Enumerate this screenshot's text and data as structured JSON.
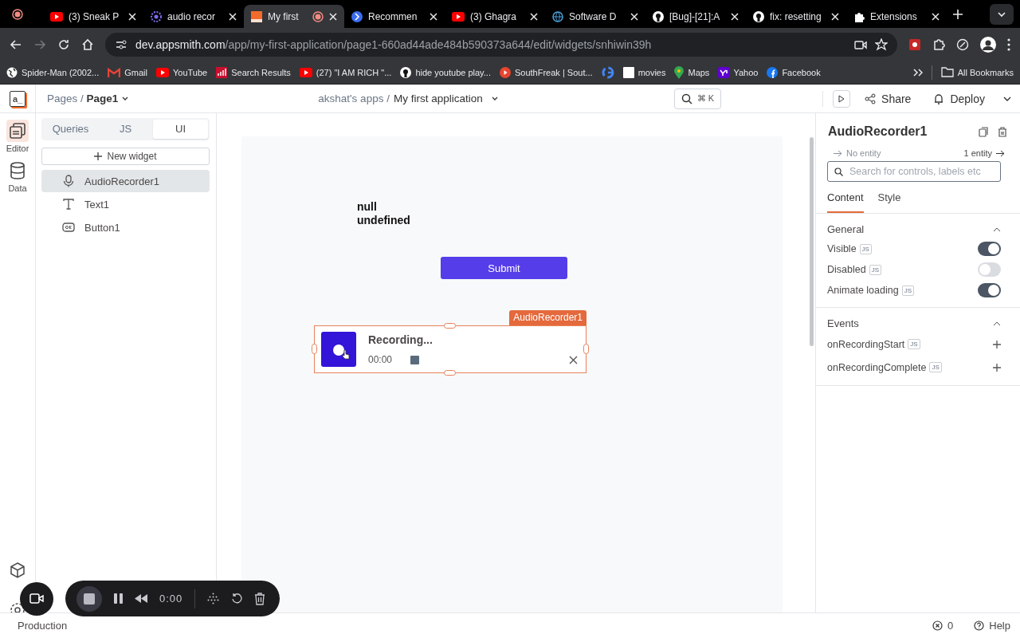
{
  "browser": {
    "tabs": [
      {
        "title": "(3) Sneak P",
        "selected": false
      },
      {
        "title": "audio recor",
        "selected": false
      },
      {
        "title": "My first",
        "selected": true
      },
      {
        "title": "Recommen",
        "selected": false
      },
      {
        "title": "(3) Ghagra",
        "selected": false
      },
      {
        "title": "Software D",
        "selected": false
      },
      {
        "title": "[Bug]-[21]:A",
        "selected": false
      },
      {
        "title": "fix: resetting",
        "selected": false
      },
      {
        "title": "Extensions",
        "selected": false
      }
    ],
    "address": {
      "host": "dev.appsmith.com",
      "path": "/app/my-first-application/page1-660ad44ade484b590373a644/edit/widgets/snhiwin39h"
    },
    "bookmarks": [
      {
        "kind": "link",
        "label": "Spider-Man (2002..."
      },
      {
        "kind": "link",
        "label": "Gmail"
      },
      {
        "kind": "link",
        "label": "YouTube"
      },
      {
        "kind": "link",
        "label": "Search Results"
      },
      {
        "kind": "link",
        "label": "(27) \"I AM RICH \"..."
      },
      {
        "kind": "link",
        "label": "hide youtube play..."
      },
      {
        "kind": "link",
        "label": "SouthFreak | Sout..."
      },
      {
        "kind": "icon"
      },
      {
        "kind": "link",
        "label": "movies"
      },
      {
        "kind": "link",
        "label": "Maps"
      },
      {
        "kind": "link",
        "label": "Yahoo"
      },
      {
        "kind": "link",
        "label": "Facebook"
      }
    ],
    "all_bookmarks": "All Bookmarks"
  },
  "header": {
    "logo": "a_",
    "pages_label": "Pages /",
    "page": "Page1",
    "workspace": "akshat's apps /",
    "app_name": "My first application",
    "search_shortcut": "⌘ K",
    "share": "Share",
    "deploy": "Deploy"
  },
  "rail": {
    "items": [
      {
        "label": "Editor",
        "selected": true
      },
      {
        "label": "Data",
        "selected": false
      }
    ]
  },
  "entities": {
    "tabs": [
      {
        "label": "Queries",
        "selected": false
      },
      {
        "label": "JS",
        "selected": false
      },
      {
        "label": "UI",
        "selected": true
      }
    ],
    "new_widget": "New widget",
    "items": [
      {
        "kind": "audio",
        "name": "AudioRecorder1",
        "selected": true
      },
      {
        "kind": "text",
        "name": "Text1",
        "selected": false
      },
      {
        "kind": "button",
        "name": "Button1",
        "selected": false
      }
    ]
  },
  "canvas": {
    "text_lines": [
      "null",
      "undefined"
    ],
    "button": "Submit",
    "recorder": {
      "tag": "AudioRecorder1",
      "selected": true,
      "status": "Recording...",
      "time": "00:00"
    }
  },
  "properties": {
    "title": "AudioRecorder1",
    "back": "No entity",
    "forward": "1 entity",
    "search_placeholder": "Search for controls, labels etc",
    "tabs": [
      {
        "label": "Content",
        "selected": true
      },
      {
        "label": "Style",
        "selected": false
      }
    ],
    "sections": [
      {
        "title": "General",
        "expanded": true,
        "rows": [
          {
            "kind": "toggle",
            "label": "Visible",
            "badge": "JS",
            "on": true
          },
          {
            "kind": "toggle",
            "label": "Disabled",
            "badge": "JS",
            "on": false
          },
          {
            "kind": "toggle",
            "label": "Animate loading",
            "badge": "JS",
            "on": true
          }
        ]
      },
      {
        "title": "Events",
        "expanded": true,
        "rows": [
          {
            "kind": "event",
            "label": "onRecordingStart",
            "badge": "JS"
          },
          {
            "kind": "event",
            "label": "onRecordingComplete",
            "badge": "JS"
          }
        ]
      }
    ]
  },
  "bottom_bar": {
    "environment": "Production",
    "error_count": "0",
    "help": "Help"
  },
  "screen_recorder": {
    "time": "0:00"
  }
}
